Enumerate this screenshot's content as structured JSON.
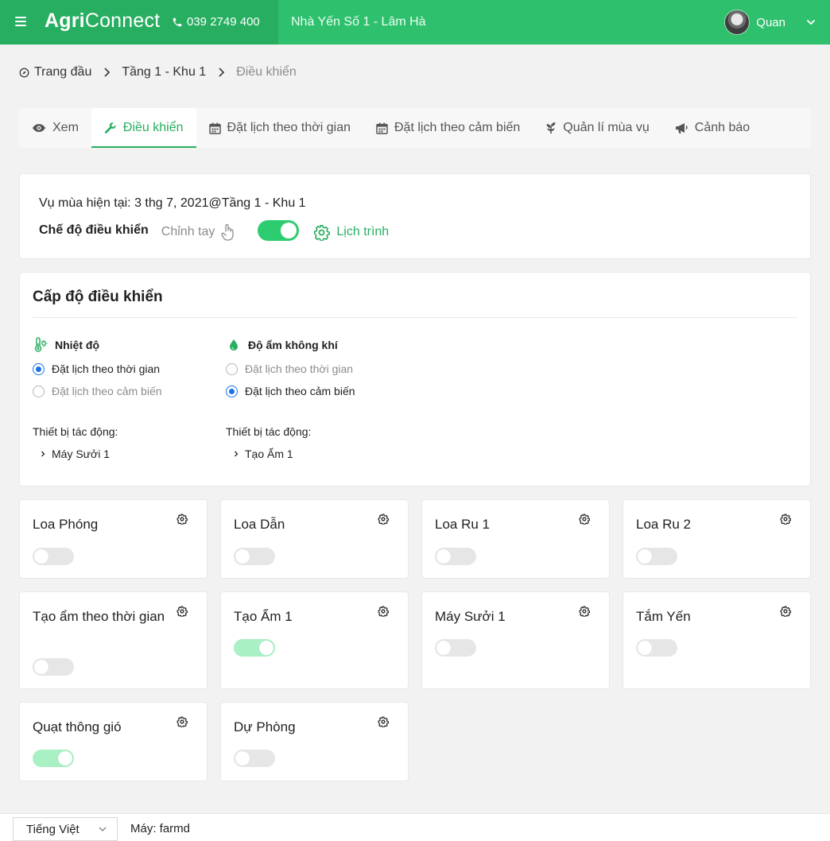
{
  "header": {
    "logo_bold": "Agri",
    "logo_rest": "Connect",
    "phone": "039 2749 400",
    "farm_name": "Nhà Yến Số 1 - Lâm Hà",
    "user_name": "Quan"
  },
  "breadcrumb": {
    "home": "Trang đầu",
    "level1": "Tầng 1 - Khu 1",
    "current": "Điều khiển"
  },
  "tabs": [
    {
      "label": "Xem",
      "icon": "eye-icon"
    },
    {
      "label": "Điều khiển",
      "icon": "wrench-icon",
      "active": true
    },
    {
      "label": "Đặt lịch theo thời gian",
      "icon": "calendar-icon"
    },
    {
      "label": "Đặt lịch theo cảm biến",
      "icon": "calendar-icon"
    },
    {
      "label": "Quản lí mùa vụ",
      "icon": "sprout-icon"
    },
    {
      "label": "Cảnh báo",
      "icon": "megaphone-icon"
    }
  ],
  "season": {
    "current_label": "Vụ mùa hiện tại: 3 thg 7, 2021@Tầng 1 - Khu 1",
    "mode_label": "Chế độ điều khiển",
    "manual_label": "Chỉnh tay",
    "schedule_label": "Lịch trình",
    "mode_is_schedule": true
  },
  "control_level": {
    "title": "Cấp độ điều khiển",
    "columns": [
      {
        "name": "Nhiệt độ",
        "icon": "thermometer-icon",
        "options": [
          "Đặt lịch theo thời gian",
          "Đặt lịch theo cảm biến"
        ],
        "selected": 0,
        "impact_label": "Thiết bị tác động:",
        "device": "Máy Sưởi 1"
      },
      {
        "name": "Độ ẩm không khí",
        "icon": "water-drop-icon",
        "options": [
          "Đặt lịch theo thời gian",
          "Đặt lịch theo cảm biến"
        ],
        "selected": 1,
        "impact_label": "Thiết bị tác động:",
        "device": "Tạo Ẩm 1"
      }
    ]
  },
  "devices": [
    {
      "name": "Loa Phóng",
      "on": false
    },
    {
      "name": "Loa Dẫn",
      "on": false
    },
    {
      "name": "Loa Ru 1",
      "on": false
    },
    {
      "name": "Loa Ru 2",
      "on": false
    },
    {
      "name": "Tạo ẩm theo thời gian",
      "on": false
    },
    {
      "name": "Tạo Ẩm 1",
      "on": true
    },
    {
      "name": "Máy Sưởi 1",
      "on": false
    },
    {
      "name": "Tắm Yến",
      "on": false
    },
    {
      "name": "Quạt thông gió",
      "on": true
    },
    {
      "name": "Dự Phòng",
      "on": false
    }
  ],
  "footer": {
    "language": "Tiếng Việt",
    "machine": "Máy: farmd"
  },
  "colors": {
    "brand": "#27ae60",
    "brand_light": "#2fc06d",
    "toggle_on": "#a9f0c4",
    "radio": "#1a73e8"
  }
}
